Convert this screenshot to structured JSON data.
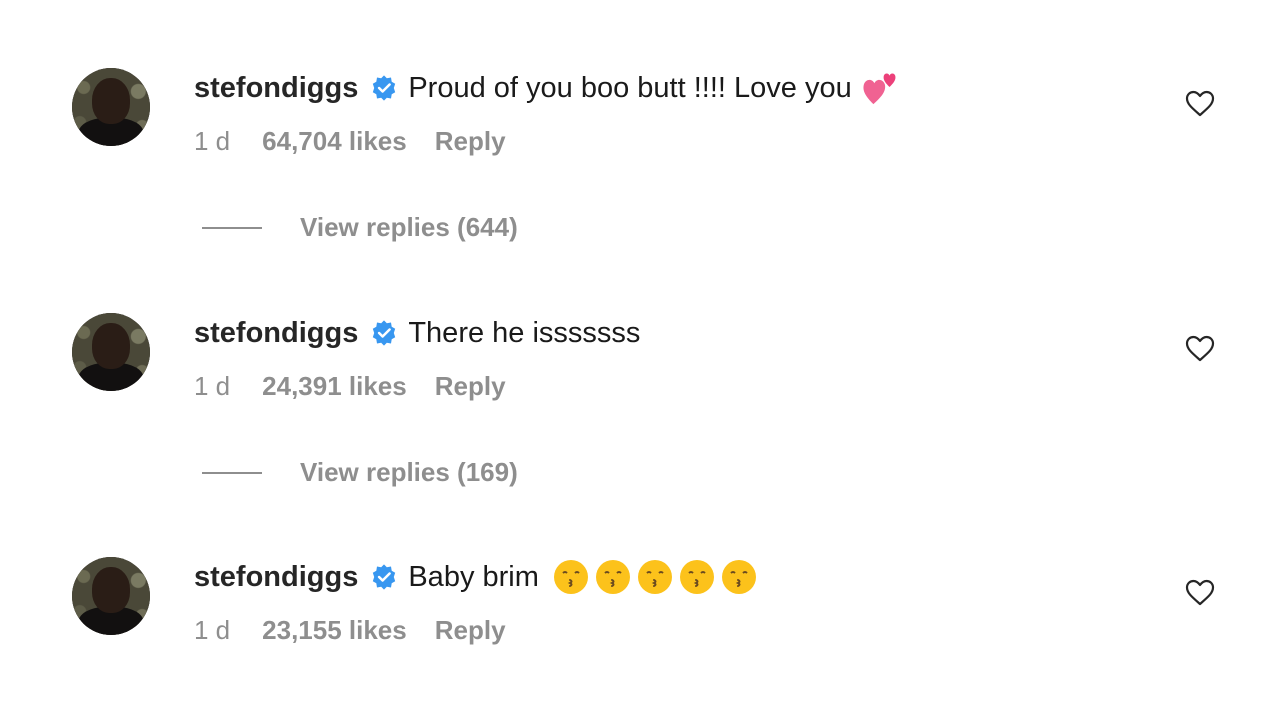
{
  "comments": [
    {
      "username": "stefondiggs",
      "text": "Proud of you boo butt !!!! Love you",
      "emoji": "two-hearts",
      "time": "1 d",
      "likes": "64,704 likes",
      "reply_label": "Reply",
      "view_replies": "View replies (644)"
    },
    {
      "username": "stefondiggs",
      "text": "There he isssssss",
      "time": "1 d",
      "likes": "24,391 likes",
      "reply_label": "Reply",
      "view_replies": "View replies (169)"
    },
    {
      "username": "stefondiggs",
      "text": "Baby brim",
      "emoji": "kissing-face",
      "time": "1 d",
      "likes": "23,155 likes",
      "reply_label": "Reply"
    }
  ],
  "colors": {
    "verified": "#3897f0",
    "muted_text": "#8e8e8e",
    "main_text": "#262626",
    "heart_emoji": "#f06292",
    "kiss_emoji": "#fcc21b"
  }
}
